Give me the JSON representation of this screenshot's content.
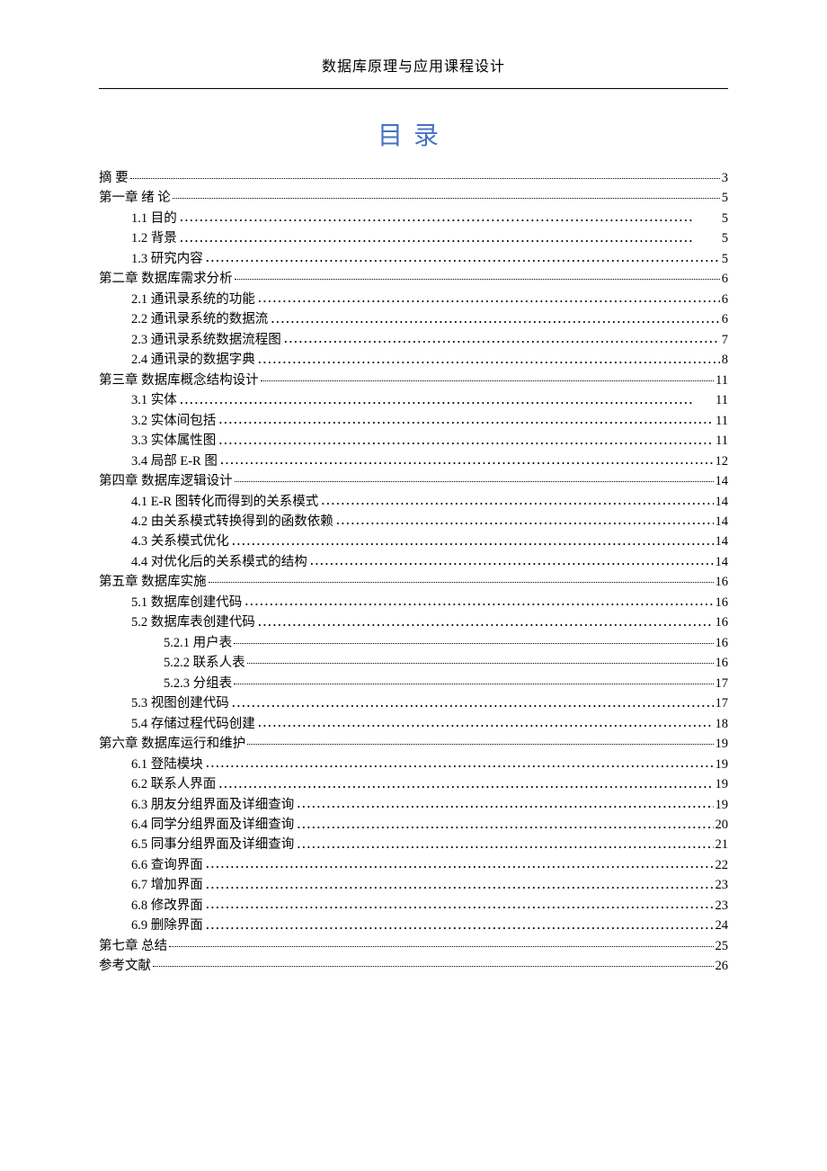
{
  "header": "数据库原理与应用课程设计",
  "toc_title": "目录",
  "entries": [
    {
      "label": "摘 要",
      "page": "3",
      "indent": 0,
      "leader": "fine"
    },
    {
      "label": "第一章 绪 论",
      "page": "5",
      "indent": 0,
      "leader": "fine"
    },
    {
      "label": "1.1 目的",
      "page": "5",
      "indent": 1,
      "leader": "coarse"
    },
    {
      "label": "1.2 背景",
      "page": "5",
      "indent": 1,
      "leader": "coarse"
    },
    {
      "label": "1.3 研究内容",
      "page": "5",
      "indent": 1,
      "leader": "coarse"
    },
    {
      "label": "第二章 数据库需求分析",
      "page": "6",
      "indent": 0,
      "leader": "fine"
    },
    {
      "label": "2.1 通讯录系统的功能",
      "page": "6",
      "indent": 1,
      "leader": "coarse"
    },
    {
      "label": "2.2 通讯录系统的数据流",
      "page": "6",
      "indent": 1,
      "leader": "coarse"
    },
    {
      "label": "2.3 通讯录系统数据流程图",
      "page": "7",
      "indent": 1,
      "leader": "coarse"
    },
    {
      "label": "2.4 通讯录的数据字典",
      "page": "8",
      "indent": 1,
      "leader": "coarse"
    },
    {
      "label": "第三章 数据库概念结构设计",
      "page": "11",
      "indent": 0,
      "leader": "fine"
    },
    {
      "label": "3.1 实体",
      "page": "11",
      "indent": 1,
      "leader": "coarse"
    },
    {
      "label": "3.2 实体间包括",
      "page": "11",
      "indent": 1,
      "leader": "coarse"
    },
    {
      "label": "3.3 实体属性图",
      "page": "11",
      "indent": 1,
      "leader": "coarse"
    },
    {
      "label": "3.4 局部 E-R 图",
      "page": "12",
      "indent": 1,
      "leader": "coarse"
    },
    {
      "label": "第四章 数据库逻辑设计",
      "page": "14",
      "indent": 0,
      "leader": "fine"
    },
    {
      "label": "4.1 E-R 图转化而得到的关系模式",
      "page": "14",
      "indent": 1,
      "leader": "coarse"
    },
    {
      "label": "4.2 由关系模式转换得到的函数依赖",
      "page": "14",
      "indent": 1,
      "leader": "coarse"
    },
    {
      "label": "4.3 关系模式优化",
      "page": "14",
      "indent": 1,
      "leader": "coarse"
    },
    {
      "label": "4.4 对优化后的关系模式的结构",
      "page": "14",
      "indent": 1,
      "leader": "coarse"
    },
    {
      "label": "第五章  数据库实施",
      "page": "16",
      "indent": 0,
      "leader": "fine"
    },
    {
      "label": "5.1 数据库创建代码",
      "page": "16",
      "indent": 1,
      "leader": "coarse"
    },
    {
      "label": "5.2 数据库表创建代码",
      "page": "16",
      "indent": 1,
      "leader": "coarse"
    },
    {
      "label": "5.2.1 用户表",
      "page": "16",
      "indent": 2,
      "leader": "fine"
    },
    {
      "label": "5.2.2 联系人表",
      "page": "16",
      "indent": 2,
      "leader": "fine"
    },
    {
      "label": "5.2.3 分组表",
      "page": "17",
      "indent": 2,
      "leader": "fine"
    },
    {
      "label": "5.3 视图创建代码",
      "page": "17",
      "indent": 1,
      "leader": "coarse"
    },
    {
      "label": "5.4 存储过程代码创建",
      "page": "18",
      "indent": 1,
      "leader": "coarse"
    },
    {
      "label": "第六章 数据库运行和维护",
      "page": "19",
      "indent": 0,
      "leader": "fine"
    },
    {
      "label": "6.1 登陆模块",
      "page": "19",
      "indent": 1,
      "leader": "coarse"
    },
    {
      "label": "6.2 联系人界面",
      "page": "19",
      "indent": 1,
      "leader": "coarse"
    },
    {
      "label": "6.3 朋友分组界面及详细查询",
      "page": "19",
      "indent": 1,
      "leader": "coarse"
    },
    {
      "label": "6.4 同学分组界面及详细查询",
      "page": "20",
      "indent": 1,
      "leader": "coarse"
    },
    {
      "label": "6.5 同事分组界面及详细查询",
      "page": "21",
      "indent": 1,
      "leader": "coarse"
    },
    {
      "label": "6.6 查询界面",
      "page": "22",
      "indent": 1,
      "leader": "coarse"
    },
    {
      "label": "6.7 增加界面",
      "page": "23",
      "indent": 1,
      "leader": "coarse"
    },
    {
      "label": "6.8 修改界面",
      "page": "23",
      "indent": 1,
      "leader": "coarse"
    },
    {
      "label": "6.9 删除界面",
      "page": "24",
      "indent": 1,
      "leader": "coarse"
    },
    {
      "label": "第七章 总结",
      "page": "25",
      "indent": 0,
      "leader": "fine"
    },
    {
      "label": "参考文献",
      "page": "26",
      "indent": 0,
      "leader": "fine"
    }
  ]
}
